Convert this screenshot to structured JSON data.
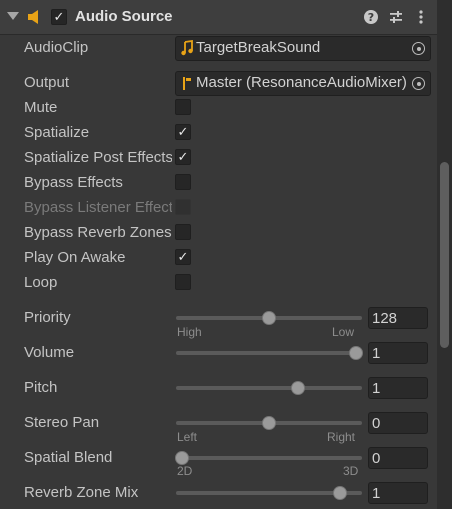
{
  "header": {
    "title": "Audio Source",
    "enabled_check": "✓",
    "icons": [
      "foldout-arrow-icon",
      "audio-source-speaker-icon",
      "help-icon",
      "presets-icon",
      "kebab-menu-icon"
    ]
  },
  "audio_clip": {
    "label": "AudioClip",
    "value": "TargetBreakSound",
    "icon": "music-note-icon"
  },
  "output": {
    "label": "Output",
    "value": "Master (ResonanceAudioMixer)",
    "icon": "mixer-icon"
  },
  "toggles": [
    {
      "label": "Mute",
      "checked": false,
      "disabled": false,
      "mark": ""
    },
    {
      "label": "Spatialize",
      "checked": true,
      "disabled": false,
      "mark": "✓"
    },
    {
      "label": "Spatialize Post Effects",
      "checked": true,
      "disabled": false,
      "mark": "✓"
    },
    {
      "label": "Bypass Effects",
      "checked": false,
      "disabled": false,
      "mark": ""
    },
    {
      "label": "Bypass Listener Effects",
      "checked": false,
      "disabled": true,
      "mark": ""
    },
    {
      "label": "Bypass Reverb Zones",
      "checked": false,
      "disabled": false,
      "mark": ""
    },
    {
      "label": "Play On Awake",
      "checked": true,
      "disabled": false,
      "mark": "✓"
    },
    {
      "label": "Loop",
      "checked": false,
      "disabled": false,
      "mark": ""
    }
  ],
  "sliders": [
    {
      "label": "Priority",
      "value": "128",
      "min": 0,
      "max": 256,
      "min_label": "High",
      "max_label": "Low"
    },
    {
      "label": "Volume",
      "value": "1",
      "min": 0,
      "max": 1,
      "min_label": "",
      "max_label": ""
    },
    {
      "label": "Pitch",
      "value": "1",
      "min": -3,
      "max": 3,
      "min_label": "",
      "max_label": ""
    },
    {
      "label": "Stereo Pan",
      "value": "0",
      "min": -1,
      "max": 1,
      "min_label": "Left",
      "max_label": "Right"
    },
    {
      "label": "Spatial Blend",
      "value": "0",
      "min": 0,
      "max": 1,
      "min_label": "2D",
      "max_label": "3D"
    },
    {
      "label": "Reverb Zone Mix",
      "value": "1",
      "min": 0,
      "max": 1.1,
      "min_label": "",
      "max_label": ""
    }
  ]
}
